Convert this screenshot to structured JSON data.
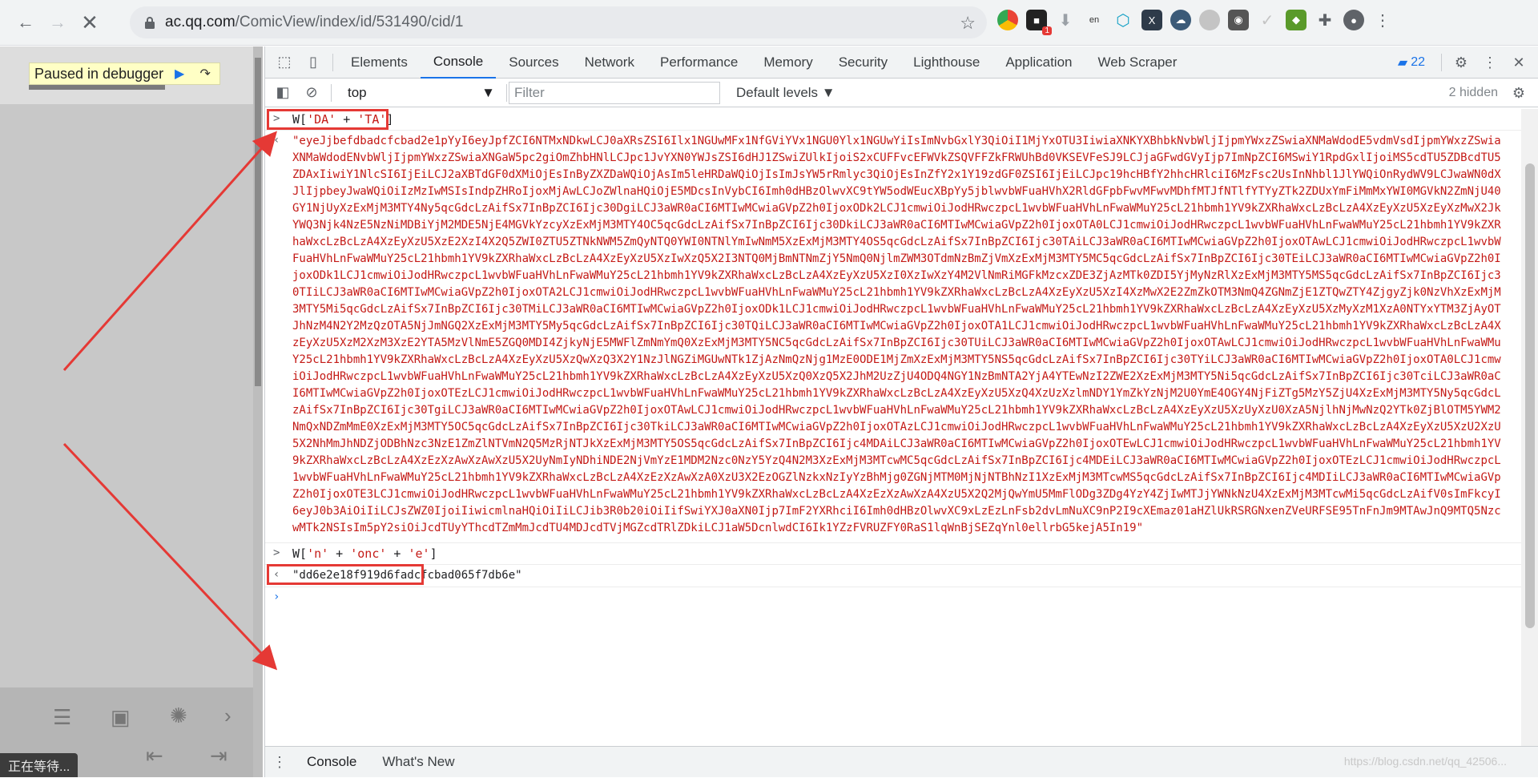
{
  "browser": {
    "url_host": "ac.qq.com",
    "url_path": "/ComicView/index/id/531490/cid/1",
    "extension_badge": "1"
  },
  "page": {
    "debugger_banner": "Paused in debugger",
    "status_text": "正在等待..."
  },
  "devtools": {
    "tabs": [
      "Elements",
      "Console",
      "Sources",
      "Network",
      "Performance",
      "Memory",
      "Security",
      "Lighthouse",
      "Application",
      "Web Scraper"
    ],
    "active_tab": "Console",
    "issues_count": "22",
    "context": "top",
    "filter_placeholder": "Filter",
    "levels_label": "Default levels ▼",
    "hidden_count": "2 hidden",
    "drawer_tabs": [
      "Console",
      "What's New"
    ],
    "watermark": "https://blog.csdn.net/qq_42506..."
  },
  "console": {
    "entries": [
      {
        "command_parts": [
          {
            "t": "W[",
            "s": false
          },
          {
            "t": "'DA'",
            "s": true
          },
          {
            "t": " + ",
            "s": false
          },
          {
            "t": "'TA'",
            "s": true
          },
          {
            "t": "]",
            "s": false
          }
        ],
        "result": "\"eyeJjbefdbadcfcbad2e1pYyI6eyJpfZCI6NTMxNDkwLCJ0aXRsZSI6Ilx1NGUwMFx1NfGViYVx1NGU0Ylx1NGUwYiIsImNvbGxlY3QiOiI1MjYxOTU3IiwiaXNKYXBhbkNvbWljIjpmYWxzZSwiaXNMaWdodE5vdmVsdIjpmYWxzZSwiaXNMaWdodENvbWljIjpmYWxzZSwiaXNGaW5pc2giOmZhbHNlLCJpc1JvYXN0YWJsZSI6dHJ1ZSwiZUlkIjoiS2xCUFFvcEFWVkZSQVFFZkFRWUhBd0VKSEVFeSJ9LCJjaGFwdGVyIjp7ImNpZCI6MSwiY1RpdGxlIjoiMS5cdTU5ZDBcdTU5ZDAxIiwiY1NlcSI6IjEiLCJ2aXBTdGF0dXMiOjEsInByZXZDaWQiOjAsIm5leHRDaWQiOjIsImJsYW5rRmlyc3QiOjEsInZfY2x1Y19zdGF0ZSI6IjEiLCJpc19hcHBfY2hhcHRlciI6MzFsc2UsInNhbl1JlYWQiOnRydWV9LCJwaWN0dXJlIjpbeyJwaWQiOiIzMzIwMSIsIndpZHRoIjoxMjAwLCJoZWlnaHQiOjE5MDcsInVybCI6Imh0dHBzOlwvXC9tYW5odWEucXBpYy5jblwvbWFuaHVhX2RldGFpbFwvMFwvMDhfMTJfNTlfYTYyZTk2ZDUxYmFiMmMxYWI0MGVkN2ZmNjU40GY1NjUyXzExMjM3MTY4Ny5qcGdcLzAifSx7InBpZCI6Ijc30DgiLCJ3aWR0aCI6MTIwMCwiaGVpZ2h0IjoxODk2LCJ1cmwiOiJodHRwczpcL1wvbWFuaHVhLnFwaWMuY25cL21hbmh1YV9kZXRhaWxcLzBcLzA4XzEyXzU5XzEyXzMwX2JkYWQ3Njk4NzE5NzNiMDBiYjM2MDE5NjE4MGVkYzcyXzExMjM3MTY4OC5qcGdcLzAifSx7InBpZCI6Ijc30DkiLCJ3aWR0aCI6MTIwMCwiaGVpZ2h0IjoxOTA0LCJ1cmwiOiJodHRwczpcL1wvbWFuaHVhLnFwaWMuY25cL21hbmh1YV9kZXRhaWxcLzBcLzA4XzEyXzU5XzE2XzI4X2Q5ZWI0ZTU5ZTNkNWM5ZmQyNTQ0YWI0NTNlYmIwNmM5XzExMjM3MTY4OS5qcGdcLzAifSx7InBpZCI6Ijc30TAiLCJ3aWR0aCI6MTIwMCwiaGVpZ2h0IjoxOTAwLCJ1cmwiOiJodHRwczpcL1wvbWFuaHVhLnFwaWMuY25cL21hbmh1YV9kZXRhaWxcLzBcLzA4XzEyXzU5XzIwXzQ5X2I3NTQ0MjBmNTNmZjY5NmQ0NjlmZWM3OTdmNzBmZjVmXzExMjM3MTY5MC5qcGdcLzAifSx7InBpZCI6Ijc30TEiLCJ3aWR0aCI6MTIwMCwiaGVpZ2h0IjoxODk1LCJ1cmwiOiJodHRwczpcL1wvbWFuaHVhLnFwaWMuY25cL21hbmh1YV9kZXRhaWxcLzBcLzA4XzEyXzU5XzI0XzIwXzY4M2VlNmRiMGFkMzcxZDE3ZjAzMTk0ZDI5YjMyNzRlXzExMjM3MTY5MS5qcGdcLzAifSx7InBpZCI6Ijc30TIiLCJ3aWR0aCI6MTIwMCwiaGVpZ2h0IjoxOTA2LCJ1cmwiOiJodHRwczpcL1wvbWFuaHVhLnFwaWMuY25cL21hbmh1YV9kZXRhaWxcLzBcLzA4XzEyXzU5XzI4XzMwX2E2ZmZkOTM3NmQ4ZGNmZjE1ZTQwZTY4ZjgyZjk0NzVhXzExMjM3MTY5Mi5qcGdcLzAifSx7InBpZCI6Ijc30TMiLCJ3aWR0aCI6MTIwMCwiaGVpZ2h0IjoxODk1LCJ1cmwiOiJodHRwczpcL1wvbWFuaHVhLnFwaWMuY25cL21hbmh1YV9kZXRhaWxcLzBcLzA4XzEyXzU5XzMyXzM1XzA0NTYxYTM3ZjAyOTJhNzM4N2Y2MzQzOTA5NjJmNGQ2XzExMjM3MTY5My5qcGdcLzAifSx7InBpZCI6Ijc30TQiLCJ3aWR0aCI6MTIwMCwiaGVpZ2h0IjoxOTA1LCJ1cmwiOiJodHRwczpcL1wvbWFuaHVhLnFwaWMuY25cL21hbmh1YV9kZXRhaWxcLzBcLzA4XzEyXzU5XzM2XzM3XzE2YTA5MzVlNmE5ZGQ0MDI4ZjkyNjE5MWFlZmNmYmQ0XzExMjM3MTY5NC5qcGdcLzAifSx7InBpZCI6Ijc30TUiLCJ3aWR0aCI6MTIwMCwiaGVpZ2h0IjoxOTAwLCJ1cmwiOiJodHRwczpcL1wvbWFuaHVhLnFwaWMuY25cL21hbmh1YV9kZXRhaWxcLzBcLzA4XzEyXzU5XzQwXzQ3X2Y1NzJlNGZiMGUwNTk1ZjAzNmQzNjg1MzE0ODE1MjZmXzExMjM3MTY5NS5qcGdcLzAifSx7InBpZCI6Ijc30TYiLCJ3aWR0aCI6MTIwMCwiaGVpZ2h0IjoxOTA0LCJ1cmwiOiJodHRwczpcL1wvbWFuaHVhLnFwaWMuY25cL21hbmh1YV9kZXRhaWxcLzBcLzA4XzEyXzU5XzQ0XzQ5X2JhM2UzZjU4ODQ4NGY1NzBmNTA2YjA4YTEwNzI2ZWE2XzExMjM3MTY5Ni5qcGdcLzAifSx7InBpZCI6Ijc30TciLCJ3aWR0aCI6MTIwMCwiaGVpZ2h0IjoxOTEzLCJ1cmwiOiJodHRwczpcL1wvbWFuaHVhLnFwaWMuY25cL21hbmh1YV9kZXRhaWxcLzBcLzA4XzEyXzU5XzQ4XzUzXzlmNDY1YmZkYzNjM2U0YmE4OGY4NjFiZTg5MzY5ZjU4XzExMjM3MTY5Ny5qcGdcLzAifSx7InBpZCI6Ijc30TgiLCJ3aWR0aCI6MTIwMCwiaGVpZ2h0IjoxOTAwLCJ1cmwiOiJodHRwczpcL1wvbWFuaHVhLnFwaWMuY25cL21hbmh1YV9kZXRhaWxcLzBcLzA4XzEyXzU5XzUyXzU0XzA5NjlhNjMwNzQ2YTk0ZjBlOTM5YWM2NmQxNDZmMmE0XzExMjM3MTY5OC5qcGdcLzAifSx7InBpZCI6Ijc30TkiLCJ3aWR0aCI6MTIwMCwiaGVpZ2h0IjoxOTAzLCJ1cmwiOiJodHRwczpcL1wvbWFuaHVhLnFwaWMuY25cL21hbmh1YV9kZXRhaWxcLzBcLzA4XzEyXzU5XzU2XzU5X2NhMmJhNDZjODBhNzc3NzE1ZmZlNTVmN2Q5MzRjNTJkXzExMjM3MTY5OS5qcGdcLzAifSx7InBpZCI6Ijc4MDAiLCJ3aWR0aCI6MTIwMCwiaGVpZ2h0IjoxOTEwLCJ1cmwiOiJodHRwczpcL1wvbWFuaHVhLnFwaWMuY25cL21hbmh1YV9kZXRhaWxcLzBcLzA4XzEzXzAwXzAwXzU5X2UyNmIyNDhiNDE2NjVmYzE1MDM2Nzc0NzY5YzQ4N2M3XzExMjM3MTcwMC5qcGdcLzAifSx7InBpZCI6Ijc4MDEiLCJ3aWR0aCI6MTIwMCwiaGVpZ2h0IjoxOTEzLCJ1cmwiOiJodHRwczpcL1wvbWFuaHVhLnFwaWMuY25cL21hbmh1YV9kZXRhaWxcLzBcLzA4XzEzXzAwXzA0XzU3X2EzOGZlNzkxNzIyYzBhMjg0ZGNjMTM0MjNjNTBhNzI1XzExMjM3MTcwMS5qcGdcLzAifSx7InBpZCI6Ijc4MDIiLCJ3aWR0aCI6MTIwMCwiaGVpZ2h0IjoxOTE3LCJ1cmwiOiJodHRwczpcL1wvbWFuaHVhLnFwaWMuY25cL21hbmh1YV9kZXRhaWxcLzBcLzA4XzEzXzAwXzA4XzU5X2Q2MjQwYmU5MmFlODg3ZDg4YzY4ZjIwMTJjYWNkNzU4XzExMjM3MTcwMi5qcGdcLzAifV0sImFkcyI6eyJ0b3AiOiIiLCJsZWZ0IjoiIiwicmlnaHQiOiIiLCJib3R0b20iOiIifSwiYXJ0aXN0Ijp7ImF2YXRhciI6Imh0dHBzOlwvXC9xLzEzLnFsb2dvLmNuXC9nP2I9cXEmaz01aHZlUkRSRGNxenZVeURFSE95TnFnJm9MTAwJnQ9MTQ5NzcwMTk2NSIsIm5pY2siOiJcdTUyYThcdTZmMmJcdTU4MDJcdTVjMGZcdTRlZDkiLCJ1aW5DcnlwdCI6Ik1YZzFVRUZFY0RaS1lqWnBjSEZqYnl0ellrbG5kejA5In19\""
      },
      {
        "command_parts": [
          {
            "t": "W[",
            "s": false
          },
          {
            "t": "'n'",
            "s": true
          },
          {
            "t": " + ",
            "s": false
          },
          {
            "t": "'onc'",
            "s": true
          },
          {
            "t": " + ",
            "s": false
          },
          {
            "t": "'e'",
            "s": true
          },
          {
            "t": "]",
            "s": false
          }
        ],
        "result": "\"dd6e2e18f919d6fadcfcbad065f7db6e\""
      }
    ]
  }
}
